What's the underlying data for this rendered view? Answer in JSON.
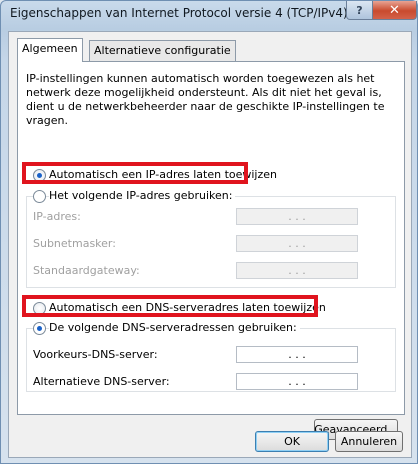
{
  "window": {
    "title": "Eigenschappen van Internet Protocol versie 4 (TCP/IPv4)",
    "help_label": "?",
    "close_label": "✕"
  },
  "tabs": [
    {
      "label": "Algemeen",
      "active": true
    },
    {
      "label": "Alternatieve configuratie",
      "active": false
    }
  ],
  "intro_text": "IP-instellingen kunnen automatisch worden toegewezen als het netwerk deze mogelijkheid ondersteunt. Als dit niet het geval is, dient u de netwerkbeheerder naar de geschikte IP-instellingen te vragen.",
  "ip": {
    "auto_label": "Automatisch een IP-adres laten toewijzen",
    "auto_selected": true,
    "manual_label": "Het volgende IP-adres gebruiken:",
    "fields": [
      {
        "label": "IP-adres:",
        "value": ". . ."
      },
      {
        "label": "Subnetmasker:",
        "value": ". . ."
      },
      {
        "label": "Standaardgateway:",
        "value": ". . ."
      }
    ]
  },
  "dns": {
    "auto_label": "Automatisch een DNS-serveradres laten toewijzen",
    "manual_label": "De volgende DNS-serveradressen gebruiken:",
    "manual_selected": true,
    "fields": [
      {
        "label": "Voorkeurs-DNS-server:",
        "value": ". . ."
      },
      {
        "label": "Alternatieve DNS-server:",
        "value": ". . ."
      }
    ]
  },
  "buttons": {
    "advanced": "Geavanceerd...",
    "ok": "OK",
    "cancel": "Annuleren"
  },
  "colors": {
    "highlight": "#e0141e",
    "radio_selected": "#1a62c9"
  }
}
